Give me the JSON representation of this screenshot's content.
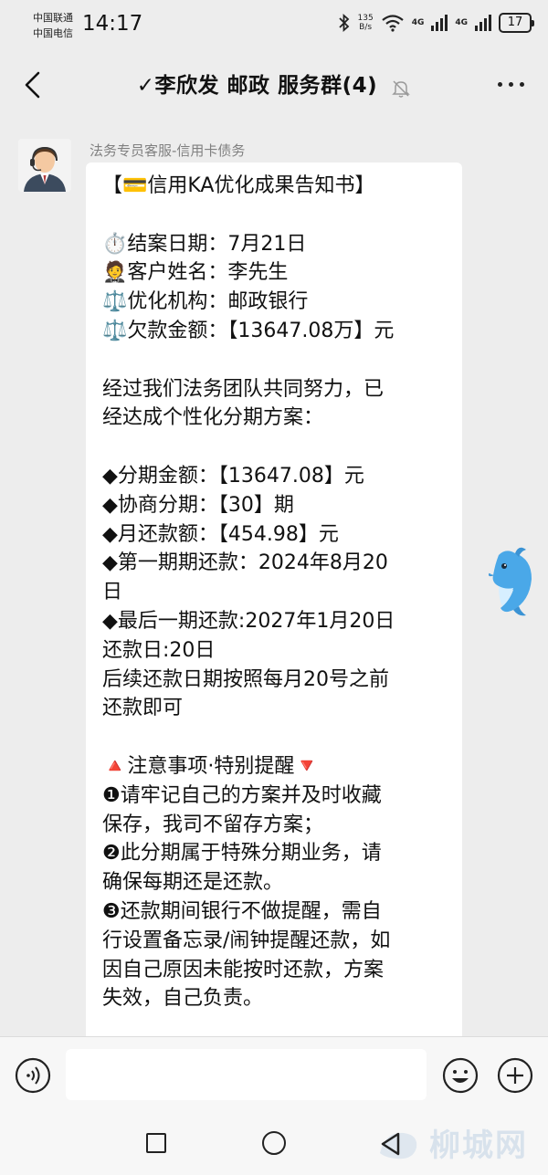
{
  "status_bar": {
    "carrier_1": "中国联通",
    "carrier_2": "中国电信",
    "time": "14:17",
    "net_speed_value": "135",
    "net_speed_unit": "B/s",
    "signal_1": "4G",
    "signal_2": "4G",
    "battery": "17"
  },
  "header": {
    "title": "✓李欣发 邮政  服务群(4)"
  },
  "message": {
    "sender": "法务专员客服-信用卡债务",
    "lines": [
      "【💳信用KA优化成果告知书】",
      "",
      "⏱️结案日期：7月21日",
      "🤵客户姓名：李先生",
      "⚖️优化机构：邮政银行",
      "⚖️欠款金额：【13647.08万】元",
      "",
      "经过我们法务团队共同努力，已",
      "经达成个性化分期方案：",
      "",
      "◆分期金额：【13647.08】元",
      "◆协商分期：【30】期",
      "◆月还款额：【454.98】元",
      "◆第一期期还款：2024年8月20",
      "日",
      "◆最后一期还款:2027年1月20日",
      "还款日:20日",
      "后续还款日期按照每月20号之前",
      "还款即可",
      "",
      "🔺注意事项·特别提醒🔻",
      "❶请牢记自己的方案并及时收藏",
      "保存，我司不留存方案；",
      "❷此分期属于特殊分期业务，请",
      "确保每期还是还款。",
      "❸还款期间银行不做提醒，需自",
      "行设置备忘录/闹钟提醒还款，如",
      "因自己原因未能按时还款，方案",
      "失效，自己负责。"
    ]
  },
  "watermark": "柳城网",
  "colors": {
    "background": "#ededed",
    "bubble": "#ffffff",
    "sender_text": "#808080"
  }
}
